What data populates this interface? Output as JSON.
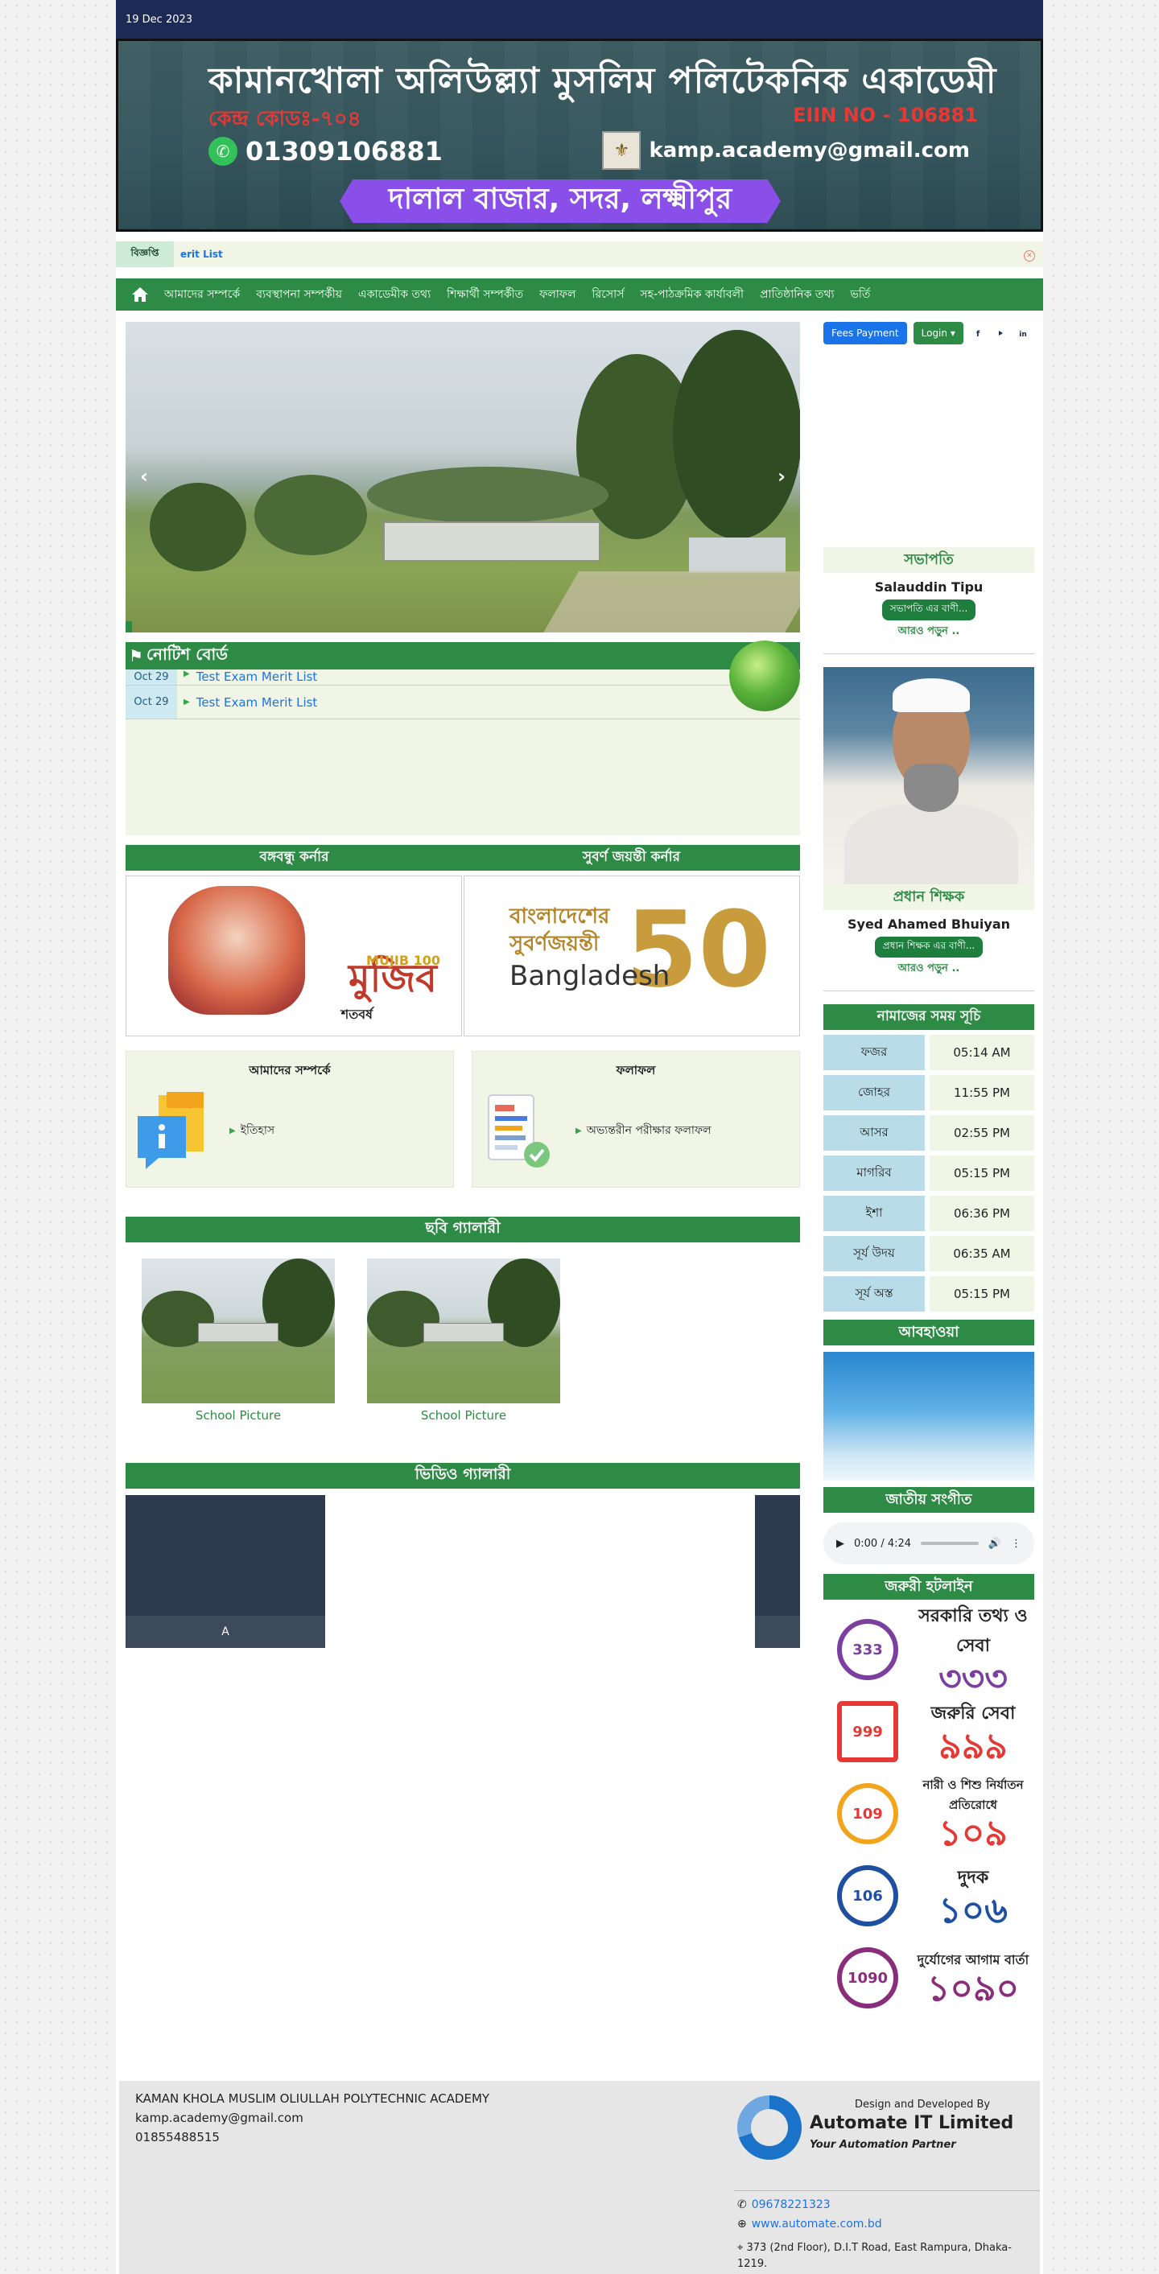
{
  "topbar": {
    "date": "19 Dec 2023",
    "fees": "Fees Payment",
    "login": "Login ▾"
  },
  "banner": {
    "name": "কামানখোলা অলিউল্ল্যা মুসলিম পলিটেকনিক একাডেমী",
    "code": "কেন্দ্র কোডঃ-৭০৪",
    "eiin": "EIIN NO - 106881",
    "phone": "01309106881",
    "email": "kamp.academy@gmail.com",
    "address": "দালাল বাজার, সদর, লক্ষ্মীপুর"
  },
  "ticker": {
    "label": "বিজ্ঞপ্তি",
    "text": "erit List"
  },
  "nav": [
    "আমাদের সম্পর্কে",
    "ব্যবস্থাপনা সম্পর্কীয়",
    "একাডেমীক তথ্য",
    "শিক্ষার্থী সম্পর্কীত",
    "ফলাফল",
    "রিসোর্স",
    "সহ-পাঠক্রমিক কার্যাবলী",
    "প্রাতিষ্ঠানিক তথ্য",
    "ভর্তি"
  ],
  "notice": {
    "title": "নোটিশ বোর্ড",
    "items": [
      {
        "date": "Oct 29",
        "title": "Test Exam Merit List"
      },
      {
        "date": "Oct 29",
        "title": "Test Exam Merit List"
      }
    ]
  },
  "corners": {
    "left_title": "বঙ্গবন্ধু কর্নার",
    "right_title": "সুবর্ণ জয়ন্তী কর্নার",
    "mujib_text": "মুজিব",
    "mujib_sub": "শতবর্ষ",
    "mujib_badge": "MUJIB 100",
    "golden_text": "বাংলাদেশের সুবর্ণজয়ন্তী",
    "golden_bd": "Bangladesh",
    "golden_num": "50"
  },
  "about_box": {
    "title": "আমাদের সম্পর্কে",
    "link": "ইতিহাস"
  },
  "result_box": {
    "title": "ফলাফল",
    "link": "অভ্যন্তরীন পরীক্ষার ফলাফল"
  },
  "gallery": {
    "title": "ছবি গ্যালারী",
    "items": [
      "School Picture",
      "School Picture"
    ]
  },
  "video": {
    "title": "ভিডিও গ্যালারী",
    "caption": "A"
  },
  "president": {
    "title": "সভাপতি",
    "name": "Salauddin Tipu",
    "pill": "সভাপতি এর বাণী...",
    "more": "আরও পড়ুন .."
  },
  "head": {
    "title": "প্রধান শিক্ষক",
    "name": "Syed Ahamed Bhuiyan",
    "pill": "প্রধান শিক্ষক এর বাণী...",
    "more": "আরও পড়ুন .."
  },
  "prayer": {
    "title": "নামাজের সময় সূচি",
    "rows": [
      {
        "name": "ফজর",
        "time": "05:14 AM"
      },
      {
        "name": "জোহর",
        "time": "11:55 PM"
      },
      {
        "name": "আসর",
        "time": "02:55 PM"
      },
      {
        "name": "মাগরিব",
        "time": "05:15 PM"
      },
      {
        "name": "ইশা",
        "time": "06:36 PM"
      },
      {
        "name": "সূর্য উদয়",
        "time": "06:35 AM"
      },
      {
        "name": "সূর্য অস্ত",
        "time": "05:15 PM"
      }
    ]
  },
  "weather": {
    "title": "আবহাওয়া"
  },
  "anthem": {
    "title": "জাতীয় সংগীত",
    "time": "0:00 / 4:24"
  },
  "hotline": {
    "title": "জরুরী হটলাইন",
    "items": [
      {
        "label": "সরকারি তথ্য ও সেবা",
        "num": "৩৩৩",
        "icon": "333",
        "color": "#7b3fa0"
      },
      {
        "label": "জরুরি সেবা",
        "num": "৯৯৯",
        "icon": "999",
        "color": "#e53935"
      },
      {
        "label": "নারী ও শিশু নির্যাতন প্রতিরোধে",
        "num": "১০৯",
        "icon": "109",
        "color": "#e53935"
      },
      {
        "label": "দুদক",
        "num": "১০৬",
        "icon": "106",
        "color": "#1f4fa0"
      },
      {
        "label": "দুর্যোগের আগাম বার্তা",
        "num": "১০৯০",
        "icon": "1090",
        "color": "#8a2d7a"
      }
    ]
  },
  "footer": {
    "school": "KAMAN KHOLA MUSLIM OLIULLAH POLYTECHNIC ACADEMY",
    "email": "kamp.academy@gmail.com",
    "phone": "01855488515",
    "design_label": "Design and Developed By",
    "company": "Automate IT Limited",
    "tagline": "Your Automation Partner",
    "c_phone": "09678221323",
    "c_web": "www.automate.com.bd",
    "c_addr": "373 (2nd Floor), D.I.T Road, East Rampura, Dhaka-1219."
  }
}
